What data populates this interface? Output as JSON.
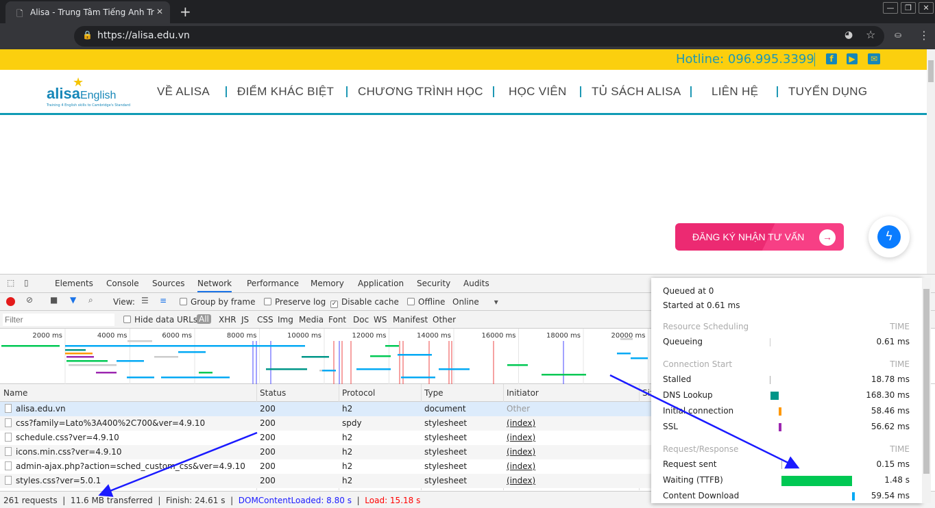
{
  "browser": {
    "tab_title": "Alisa - Trung Tâm Tiếng Anh Tr",
    "url": "https://alisa.edu.vn"
  },
  "site": {
    "hotline": "Hotline: 096.995.3399",
    "logo_text": "alisaEnglish",
    "logo_tagline": "Training 4 English skills to Cambridge's Standard",
    "nav": [
      "VỀ ALISA",
      "ĐIỂM KHÁC BIỆT",
      "CHƯƠNG TRÌNH HỌC",
      "HỌC VIÊN",
      "TỦ SÁCH ALISA",
      "LIÊN HỆ",
      "TUYỂN DỤNG"
    ],
    "cta": "ĐĂNG KÝ NHẬN TƯ VẤN",
    "colors": {
      "topbar": "#fbcf0e",
      "accent": "#1e98b4",
      "cta": "#ec2a72"
    }
  },
  "devtools": {
    "tabs": [
      "Elements",
      "Console",
      "Sources",
      "Network",
      "Performance",
      "Memory",
      "Application",
      "Security",
      "Audits"
    ],
    "active_tab": "Network",
    "toolbar": {
      "view": "View:",
      "group_by_frame": "Group by frame",
      "preserve_log": "Preserve log",
      "disable_cache": "Disable cache",
      "disable_cache_checked": true,
      "offline": "Offline",
      "throttle": "Online"
    },
    "filter": {
      "placeholder": "Filter",
      "hide_data_urls": "Hide data URLs",
      "types": [
        "All",
        "XHR",
        "JS",
        "CSS",
        "Img",
        "Media",
        "Font",
        "Doc",
        "WS",
        "Manifest",
        "Other"
      ]
    },
    "overview_ticks": [
      "2000 ms",
      "4000 ms",
      "6000 ms",
      "8000 ms",
      "10000 ms",
      "12000 ms",
      "14000 ms",
      "16000 ms",
      "18000 ms",
      "20000 ms"
    ],
    "columns": [
      "Name",
      "Status",
      "Protocol",
      "Type",
      "Initiator",
      "Size"
    ],
    "rows": [
      {
        "name": "alisa.edu.vn",
        "status": "200",
        "protocol": "h2",
        "type": "document",
        "initiator": "Other"
      },
      {
        "name": "css?family=Lato%3A400%2C700&ver=4.9.10",
        "status": "200",
        "protocol": "spdy",
        "type": "stylesheet",
        "initiator": "(index)"
      },
      {
        "name": "schedule.css?ver=4.9.10",
        "status": "200",
        "protocol": "h2",
        "type": "stylesheet",
        "initiator": "(index)"
      },
      {
        "name": "icons.min.css?ver=4.9.10",
        "status": "200",
        "protocol": "h2",
        "type": "stylesheet",
        "initiator": "(index)"
      },
      {
        "name": "admin-ajax.php?action=sched_custom_css&ver=4.9.10",
        "status": "200",
        "protocol": "h2",
        "type": "stylesheet",
        "initiator": "(index)"
      },
      {
        "name": "styles.css?ver=5.0.1",
        "status": "200",
        "protocol": "h2",
        "type": "stylesheet",
        "initiator": "(index)"
      }
    ],
    "status": {
      "requests": "261 requests",
      "transferred": "11.6 MB transferred",
      "finish": "Finish: 24.61 s",
      "dcl": "DOMContentLoaded: 8.80 s",
      "load": "Load: 15.18 s"
    },
    "timing": {
      "queued": "Queued at 0",
      "started": "Started at 0.61 ms",
      "time_label": "TIME",
      "sections": [
        {
          "title": "Resource Scheduling",
          "items": [
            {
              "label": "Queueing",
              "value": "0.61 ms",
              "color": "#cccccc"
            }
          ]
        },
        {
          "title": "Connection Start",
          "items": [
            {
              "label": "Stalled",
              "value": "18.78 ms",
              "color": "#aaaaaa"
            },
            {
              "label": "DNS Lookup",
              "value": "168.30 ms",
              "color": "#009688"
            },
            {
              "label": "Initial connection",
              "value": "58.46 ms",
              "color": "#ff9800"
            },
            {
              "label": "SSL",
              "value": "56.62 ms",
              "color": "#9c27b0"
            }
          ]
        },
        {
          "title": "Request/Response",
          "items": [
            {
              "label": "Request sent",
              "value": "0.15 ms",
              "color": "#aaaaaa"
            },
            {
              "label": "Waiting (TTFB)",
              "value": "1.48 s",
              "color": "#00c853"
            },
            {
              "label": "Content Download",
              "value": "59.54 ms",
              "color": "#03a9f4"
            }
          ]
        }
      ]
    }
  }
}
